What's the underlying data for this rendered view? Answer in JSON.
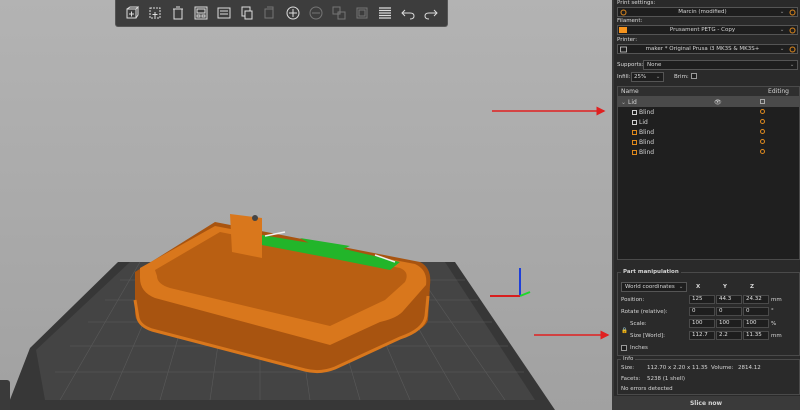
{
  "toolbar": {
    "items": [
      {
        "icon": "add-object-icon",
        "enabled": true
      },
      {
        "icon": "delete-icon",
        "enabled": true
      },
      {
        "icon": "delete-all-icon",
        "enabled": true
      },
      {
        "icon": "arrange-icon",
        "enabled": true
      },
      {
        "icon": "copy-icon",
        "enabled": true
      },
      {
        "icon": "paste-icon",
        "enabled": false
      },
      {
        "icon": "add-instance-icon",
        "enabled": true
      },
      {
        "icon": "remove-instance-icon",
        "enabled": false
      },
      {
        "icon": "split-objects-icon",
        "enabled": false
      },
      {
        "icon": "split-parts-icon",
        "enabled": false
      },
      {
        "icon": "layers-editing-icon",
        "enabled": true
      },
      {
        "icon": "undo-icon",
        "enabled": true
      },
      {
        "icon": "redo-icon",
        "enabled": true
      }
    ]
  },
  "panel": {
    "print_settings_label": "Print settings:",
    "print_settings_value": "Marcin (modified)",
    "filament_label": "Filament:",
    "filament_value": "Prusament PETG - Copy",
    "filament_color": "#f7941d",
    "printer_label": "Printer:",
    "printer_value": "maker * Original Prusa i3 MK3S & MK3S+",
    "supports_label": "Supports:",
    "supports_value": "None",
    "infill_label": "Infill:",
    "infill_value": "25%",
    "brim_label": "Brim:"
  },
  "object_list": {
    "col_name": "Name",
    "col_editing": "Editing",
    "object_name": "Lid",
    "parts": [
      "Blind",
      "Lid",
      "Blind",
      "Blind",
      "Blind"
    ]
  },
  "part_manipulation": {
    "title": "Part manipulation",
    "coord_mode": "World coordinates",
    "axis_x": "X",
    "axis_y": "Y",
    "axis_z": "Z",
    "position_label": "Position:",
    "position": [
      "125",
      "44.3",
      "24.32"
    ],
    "position_unit": "mm",
    "rotate_label": "Rotate (relative):",
    "rotate": [
      "0",
      "0",
      "0"
    ],
    "rotate_unit": "°",
    "scale_label": "Scale:",
    "scale": [
      "100",
      "100",
      "100"
    ],
    "scale_unit": "%",
    "size_label": "Size [World]:",
    "size": [
      "112.7",
      "2.2",
      "11.35"
    ],
    "size_unit": "mm",
    "inches_label": "Inches"
  },
  "info": {
    "title": "Info",
    "size_label": "Size:",
    "size_value": "112.70 x 2.20 x 11.35",
    "volume_label": "Volume:",
    "volume_value": "2814.12",
    "facets_label": "Facets:",
    "facets_value": "5238 (1 shell)",
    "errors": "No errors detected"
  },
  "slice_button": "Slice now",
  "colors": {
    "model": "#d9771c",
    "model_dark": "#a85410",
    "selected_part": "#22b52a",
    "annotation_arrow": "#e02020",
    "bed": "#3a3a3a"
  }
}
